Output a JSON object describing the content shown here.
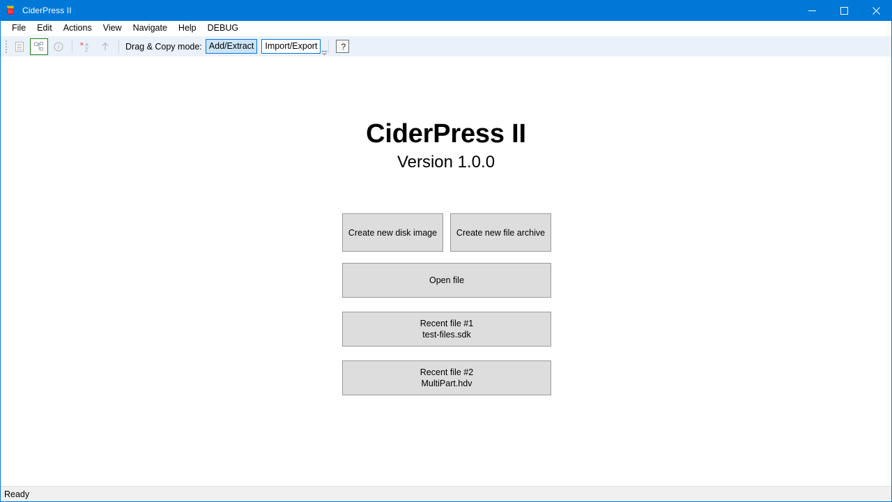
{
  "window": {
    "title": "CiderPress II",
    "app_icon": "ciderpress-app-icon",
    "accent_color": "#0078d7",
    "controls": {
      "minimize": "─",
      "maximize": "☐",
      "close": "✕"
    }
  },
  "menubar": {
    "items": [
      {
        "label": "File"
      },
      {
        "label": "Edit"
      },
      {
        "label": "Actions"
      },
      {
        "label": "View"
      },
      {
        "label": "Navigate"
      },
      {
        "label": "Help"
      },
      {
        "label": "DEBUG"
      }
    ]
  },
  "toolbar": {
    "grip": "drag-grip",
    "buttons": [
      {
        "name": "file-list-view-icon",
        "checked": false
      },
      {
        "name": "tree-view-icon",
        "checked": true
      },
      {
        "name": "info-icon",
        "checked": false
      },
      {
        "name": "clear-sort-icon",
        "checked": false
      },
      {
        "name": "navigate-up-icon",
        "checked": false
      }
    ],
    "drag_copy_label": "Drag & Copy mode:",
    "mode_add_extract": "Add/Extract",
    "mode_import_export": "Import/Export",
    "selected_mode": "Add/Extract",
    "help_label": "?",
    "overflow_label": "▼"
  },
  "main": {
    "title": "CiderPress II",
    "version": "Version 1.0.0",
    "buttons": {
      "create_disk_image": "Create new disk image",
      "create_file_archive": "Create new file archive",
      "open_file": "Open file",
      "recent1_title": "Recent file #1",
      "recent1_name": "test-files.sdk",
      "recent2_title": "Recent file #2",
      "recent2_name": "MultiPart.hdv"
    }
  },
  "statusbar": {
    "text": "Ready"
  }
}
